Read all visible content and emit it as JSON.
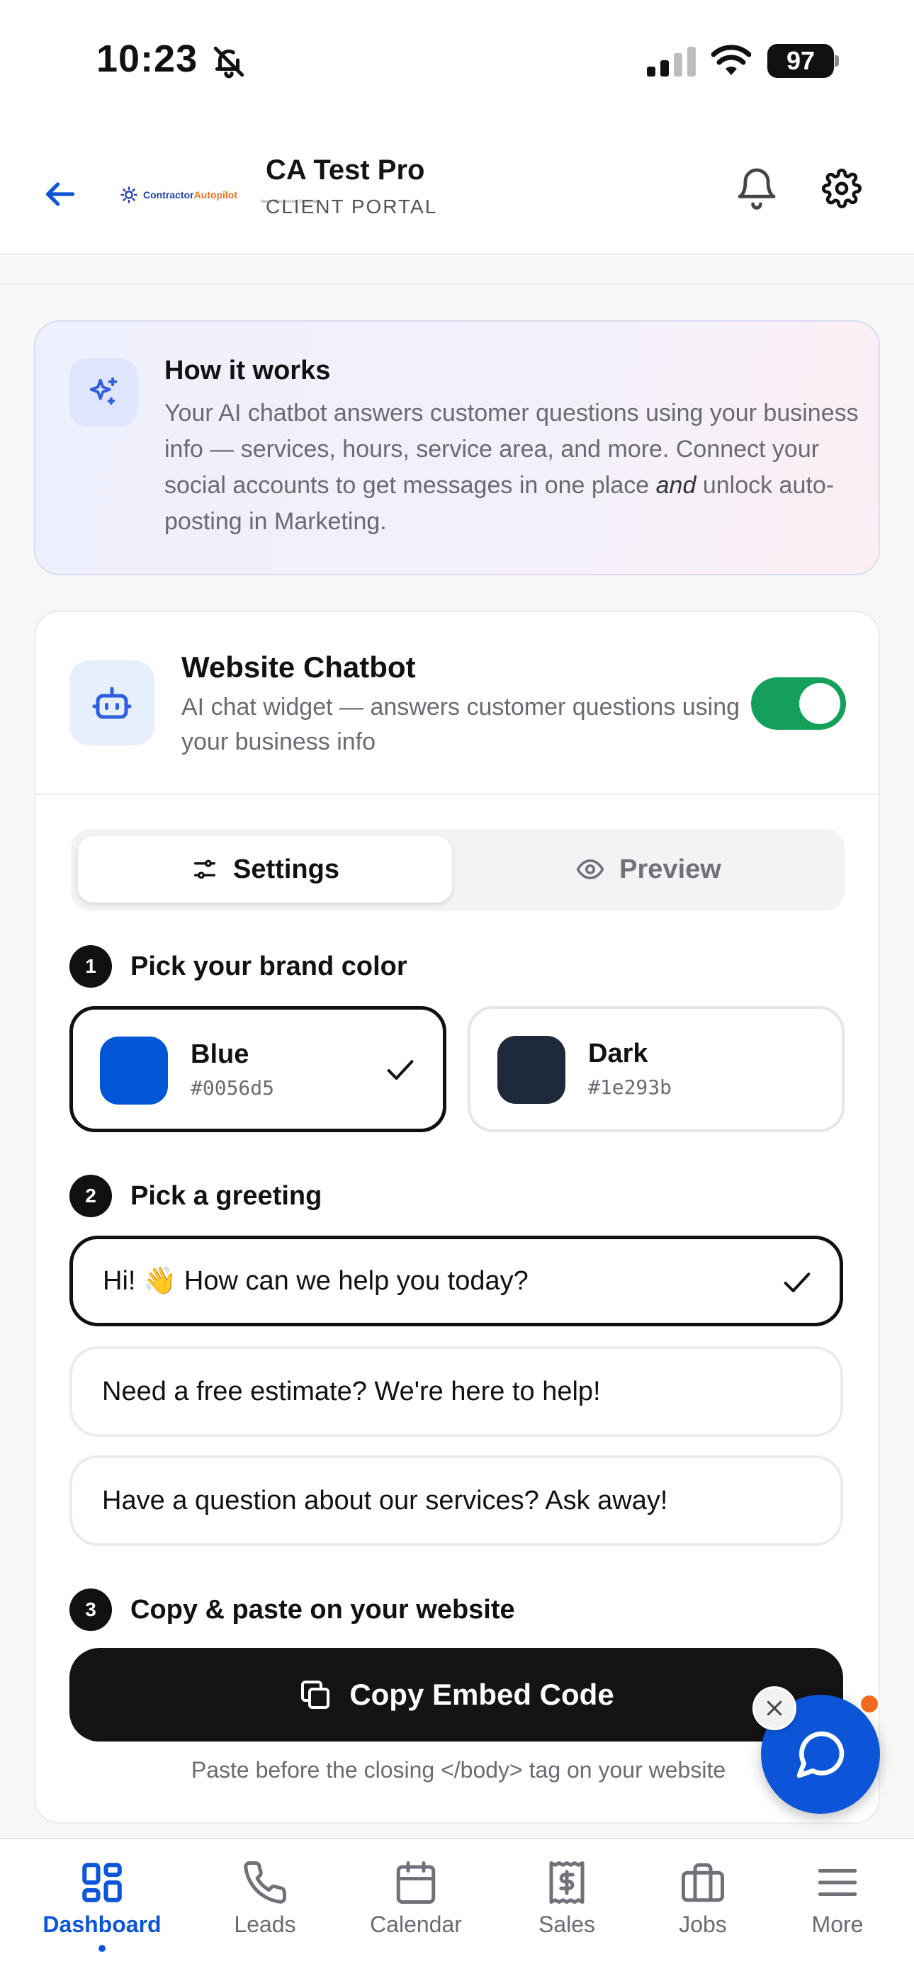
{
  "status_bar": {
    "time": "10:23",
    "battery": "97"
  },
  "header": {
    "title": "CA Test Pro",
    "subtitle": "CLIENT PORTAL",
    "logo_text_a": "Contractor",
    "logo_text_b": "Autopilot",
    "logo_tag": "Never Miss Another Customer"
  },
  "how_it_works": {
    "title": "How it works",
    "body_1": "Your AI chatbot answers customer questions using your business info — services, hours, service area, and more. Connect your social accounts to get messages in one place ",
    "body_em": "and",
    "body_2": " unlock auto-posting in Marketing."
  },
  "chatbot": {
    "title": "Website Chatbot",
    "description": "AI chat widget — answers customer questions using your business info",
    "enabled": true,
    "tabs": {
      "settings": "Settings",
      "preview": "Preview"
    },
    "step1": {
      "num": "1",
      "label": "Pick your brand color"
    },
    "colors": [
      {
        "name": "Blue",
        "hex": "#0056d5",
        "selected": true
      },
      {
        "name": "Dark",
        "hex": "#1e293b",
        "selected": false
      }
    ],
    "step2": {
      "num": "2",
      "label": "Pick a greeting"
    },
    "greetings": [
      {
        "text": "Hi! 👋 How can we help you today?",
        "selected": true
      },
      {
        "text": "Need a free estimate? We're here to help!",
        "selected": false
      },
      {
        "text": "Have a question about our services? Ask away!",
        "selected": false
      }
    ],
    "step3": {
      "num": "3",
      "label": "Copy & paste on your website"
    },
    "copy_button": "Copy Embed Code",
    "copy_hint": "Paste before the closing </body> tag on your website"
  },
  "nav": [
    {
      "label": "Dashboard",
      "active": true
    },
    {
      "label": "Leads",
      "active": false
    },
    {
      "label": "Calendar",
      "active": false
    },
    {
      "label": "Sales",
      "active": false
    },
    {
      "label": "Jobs",
      "active": false
    },
    {
      "label": "More",
      "active": false
    }
  ],
  "colors": {
    "accent": "#0c55d8",
    "toggle_on": "#14a05a",
    "notification_dot": "#f46a1e"
  }
}
